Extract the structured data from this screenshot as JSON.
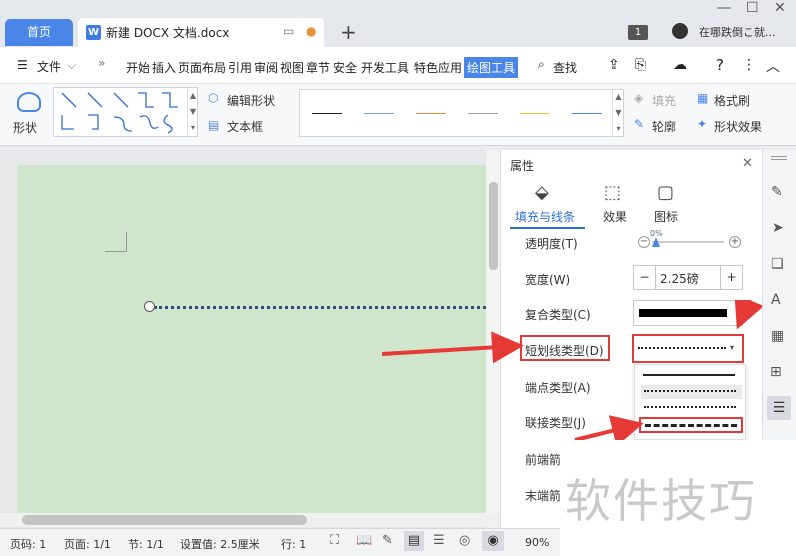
{
  "tabs": {
    "home": "首页",
    "doc_title": "新建 DOCX 文档.docx",
    "doc_icon": "W"
  },
  "titlebar": {
    "counter": "1",
    "search_hint": "在哪跌倒こ就..."
  },
  "menu": {
    "file": "文件",
    "items": [
      "开始",
      "插入",
      "页面布局",
      "引用",
      "审阅",
      "视图",
      "章节",
      "安全",
      "开发工具",
      "特色应用",
      "绘图工具"
    ],
    "search": "查找"
  },
  "ribbon": {
    "shape_label": "形状",
    "edit_shape": "编辑形状",
    "textbox": "文本框",
    "fill": "填充",
    "format_painter": "格式刷",
    "outline": "轮廓",
    "shape_effects": "形状效果",
    "line_colors": [
      "#1f1f1f",
      "#6fa8dc",
      "#e69138",
      "#9e9e9e",
      "#f1c232",
      "#4a86e8"
    ]
  },
  "panel": {
    "title": "属性",
    "tabs": [
      "填充与线条",
      "效果",
      "图标"
    ],
    "transparency_label": "透明度(T)",
    "transparency_value": "0%",
    "width_label": "宽度(W)",
    "width_value": "2.25磅",
    "compound_label": "复合类型(C)",
    "dash_label": "短划线类型(D)",
    "cap_label": "端点类型(A)",
    "join_label": "联接类型(J)",
    "front_label": "前端箭",
    "end_label": "末端箭"
  },
  "status": {
    "page_code": "页码: 1",
    "page": "页面: 1/1",
    "section": "节: 1/1",
    "setting": "设置值: 2.5厘米",
    "row": "行: 1",
    "zoom": "90%"
  },
  "watermark": "软件技巧",
  "colors": {
    "accent": "#4a86e8",
    "red": "#e53935",
    "page": "#cfe6cc",
    "dotted_line": "#2d4f7c"
  }
}
